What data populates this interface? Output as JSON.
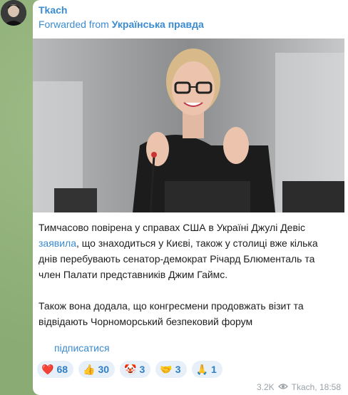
{
  "post": {
    "author": "Tkach",
    "forwarded_prefix": "Forwarded from",
    "forwarded_source": "Українська правда",
    "paragraph1_a": "Тимчасово повірена у справах США в Україні Джулі Девіс",
    "paragraph1_link": "заявила",
    "paragraph1_b": ", що знаходиться у Києві, також у столиці вже кілька днів перебувають сенатор-демократ Річард Блюменталь та член Палати представників Джим Гаймс.",
    "paragraph2": "Також вона додала, що конгресмени продовжать візит та відвідають Чорноморський безпековий форум",
    "subscribe_label": "підписатися",
    "views": "3.2K",
    "signature": "Tkach, 18:58"
  },
  "reactions": [
    {
      "emoji": "❤️",
      "icon": "heart-icon",
      "count": "68"
    },
    {
      "emoji": "👍",
      "icon": "thumbs-up-icon",
      "count": "30"
    },
    {
      "emoji": "🤡",
      "icon": "clown-icon",
      "count": "3"
    },
    {
      "emoji": "🤝",
      "icon": "handshake-icon",
      "count": "3"
    },
    {
      "emoji": "🙏",
      "icon": "pray-icon",
      "count": "1"
    }
  ],
  "colors": {
    "accent": "#3a8bd0",
    "background": "#8fb07a",
    "reaction_bg": "#e7f0f8"
  }
}
